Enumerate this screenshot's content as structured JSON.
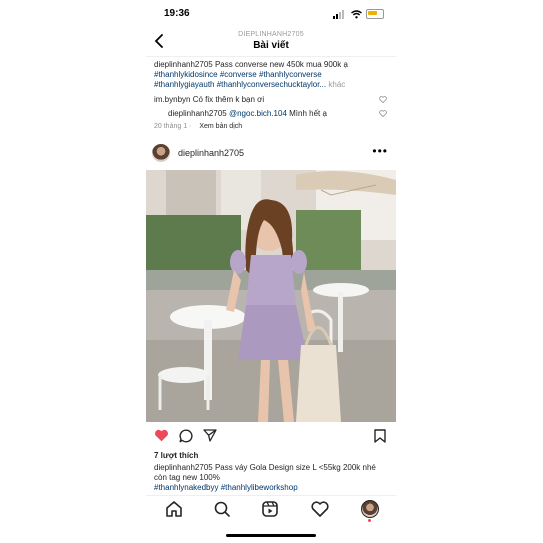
{
  "status_bar": {
    "time": "19:36"
  },
  "header": {
    "back_icon": "chevron-left-icon",
    "username": "DIEPLINHANH2705",
    "title": "Bài viết"
  },
  "caption": {
    "username": "dieplinhanh2705",
    "text": " Pass converse new 450k mua 900k ạ",
    "tags": [
      "#thanhlykidosince",
      "#converse",
      "#thanhlyconverse",
      "#thanhlygiayauth",
      "#thanhlyconversechucktaylor..."
    ],
    "more": "khác"
  },
  "comments": [
    {
      "username": "im.bynbyn",
      "text": " Có fix thêm k bạn ơi"
    },
    {
      "username": "dieplinhanh2705",
      "mention": "@ngoc.bich.104",
      "text": " Mình hết ạ"
    }
  ],
  "comment_meta": {
    "date": "20 tháng 1",
    "separator": "·",
    "translate": "Xem bản dịch"
  },
  "post": {
    "username": "dieplinhanh2705",
    "more_icon": "more-dots-icon",
    "likes": "7 lượt thích",
    "caption_username": "dieplinhanh2705",
    "caption_text": " Pass váy Gola Design size L <55kg 200k nhé còn tag new 100%",
    "caption_tags": "#thanhlynakedbyy #thanhlylibeworkshop"
  },
  "icons": {
    "like": "heart-filled-icon",
    "comment": "comment-bubble-icon",
    "share": "send-icon",
    "save": "bookmark-icon",
    "tabs": [
      "home-icon",
      "search-icon",
      "reels-icon",
      "heart-icon",
      "profile-avatar-icon"
    ]
  },
  "colors": {
    "like_red": "#ed4956",
    "hashtag": "#00376b",
    "muted": "#8e8e8e",
    "dress": "#b7a6c9"
  }
}
